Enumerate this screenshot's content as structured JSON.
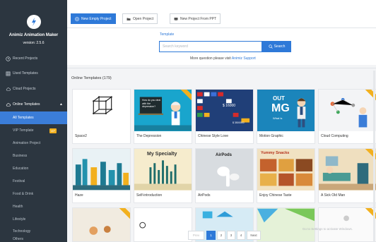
{
  "app": {
    "name": "Animiz Animation Maker",
    "version": "version: 2.5.6"
  },
  "sidebar": {
    "items": [
      {
        "label": "Recent Projects",
        "icon": "clock-icon"
      },
      {
        "label": "Used Templates",
        "icon": "grid-icon"
      },
      {
        "label": "Cloud Projects",
        "icon": "cloud-icon"
      },
      {
        "label": "Online Templates",
        "icon": "cloud-icon",
        "expanded": true
      }
    ],
    "sub_items": [
      {
        "label": "All Templates",
        "active": true
      },
      {
        "label": "VIP Template",
        "badge": "VIP"
      },
      {
        "label": "Animation Project"
      },
      {
        "label": "Business"
      },
      {
        "label": "Education"
      },
      {
        "label": "Festival"
      },
      {
        "label": "Food & Drink"
      },
      {
        "label": "Health"
      },
      {
        "label": "Lifestyle"
      },
      {
        "label": "Technology"
      },
      {
        "label": "Others"
      }
    ]
  },
  "toolbar": {
    "new_empty": "New Empty Project",
    "open": "Open Project",
    "new_from_ppt": "New Project From PPT"
  },
  "search": {
    "label": "Template",
    "placeholder": "Search keyword",
    "button": "Search",
    "hint_prefix": "More question please visit ",
    "hint_link": "Animiz Support"
  },
  "templates": {
    "section_title": "Online Templates (179)",
    "cards": [
      {
        "label": "Space2"
      },
      {
        "label": "The Depression",
        "vip": true
      },
      {
        "label": "Chinese Style Love"
      },
      {
        "label": "Motion Graphic"
      },
      {
        "label": "Cloud Computing",
        "vip": true
      },
      {
        "label": "Haze"
      },
      {
        "label": "Self-introduction"
      },
      {
        "label": "AirPods"
      },
      {
        "label": "Enjoy Chinese Taste"
      },
      {
        "label": "A Sick Old Man"
      }
    ],
    "thumb_text": {
      "depression": "How do you deal with the depression?",
      "chinese_amount": "$ 16000",
      "chinese_amount2": "$ 3500000",
      "motion_out": "OUT",
      "motion_mg": "MG",
      "motion_what": "What is",
      "specialty": "My Specialty",
      "airpods": "AirPods",
      "yummy": "Yummy Snacks"
    }
  },
  "pagination": {
    "prev": "Prev",
    "pages": [
      "1",
      "2",
      "3",
      "4"
    ],
    "current": "1",
    "next": "Next"
  },
  "watermark": "Go to Settings to activate Windows.",
  "colors": {
    "accent": "#2e79d8",
    "sidebar_bg": "#2c3640",
    "vip": "#f2b01e"
  }
}
